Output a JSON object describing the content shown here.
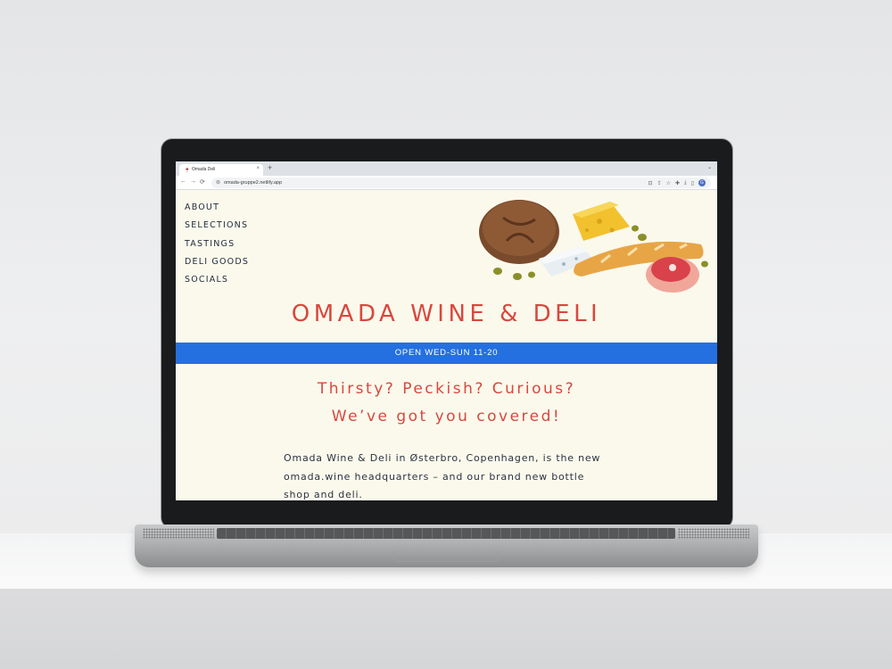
{
  "browser": {
    "tab_title": "Omada Deli",
    "favicon_glyph": "🍷",
    "close_glyph": "×",
    "new_tab_glyph": "+",
    "tab_menu_glyph": "⌄",
    "url": "omada-gruppe2.netlify.app",
    "back_glyph": "←",
    "forward_glyph": "→",
    "reload_glyph": "⟳",
    "lock_glyph": "⊜",
    "toolbar_icons": [
      "⊡",
      "⇪",
      "☆",
      "✚",
      "⤓",
      "▯"
    ],
    "profile_initial": "G"
  },
  "nav": {
    "items": [
      "ABOUT",
      "SELECTIONS",
      "TASTINGS",
      "DELI GOODS",
      "SOCIALS"
    ]
  },
  "header": {
    "title": "OMADA WINE & DELI"
  },
  "banner": {
    "hours": "OPEN WED-SUN 11-20"
  },
  "hero": {
    "line1": "Thirsty? Peckish? Curious?",
    "line2": "We’ve got you covered!"
  },
  "intro": {
    "text": "Omada Wine & Deli in Østerbro, Copenhagen, is the new omada.wine headquarters – and our brand new bottle shop and deli."
  },
  "colors": {
    "accent_red": "#d9473e",
    "banner_blue": "#2470e0",
    "page_bg": "#fbf9ec",
    "nav_text": "#1e2a3a"
  }
}
